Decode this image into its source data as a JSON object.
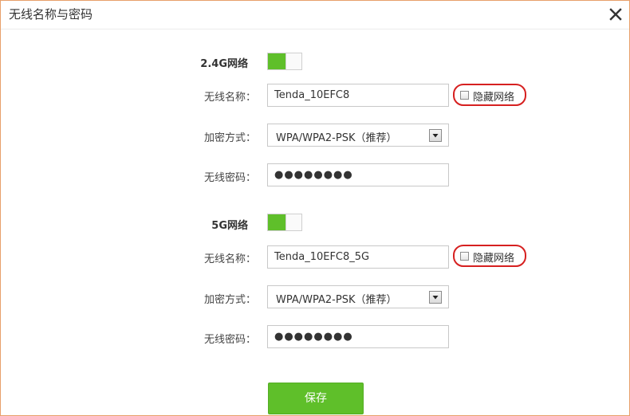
{
  "dialog": {
    "title": "无线名称与密码",
    "close_icon": "close-icon"
  },
  "bands": [
    {
      "label": "2.4G网络",
      "enabled": true,
      "ssid_label": "无线名称：",
      "ssid_value": "Tenda_10EFC8",
      "hide_label": "隐藏网络",
      "hide_checked": false,
      "security_label": "加密方式：",
      "security_value": "WPA/WPA2-PSK（推荐）",
      "password_label": "无线密码：",
      "password_value": "●●●●●●●●"
    },
    {
      "label": "5G网络",
      "enabled": true,
      "ssid_label": "无线名称：",
      "ssid_value": "Tenda_10EFC8_5G",
      "hide_label": "隐藏网络",
      "hide_checked": false,
      "security_label": "加密方式：",
      "security_value": "WPA/WPA2-PSK（推荐）",
      "password_label": "无线密码：",
      "password_value": "●●●●●●●●"
    }
  ],
  "save_label": "保存",
  "colors": {
    "accent_green": "#5fbf2a",
    "highlight_red": "#d62020",
    "border_orange": "#e8a06a"
  }
}
